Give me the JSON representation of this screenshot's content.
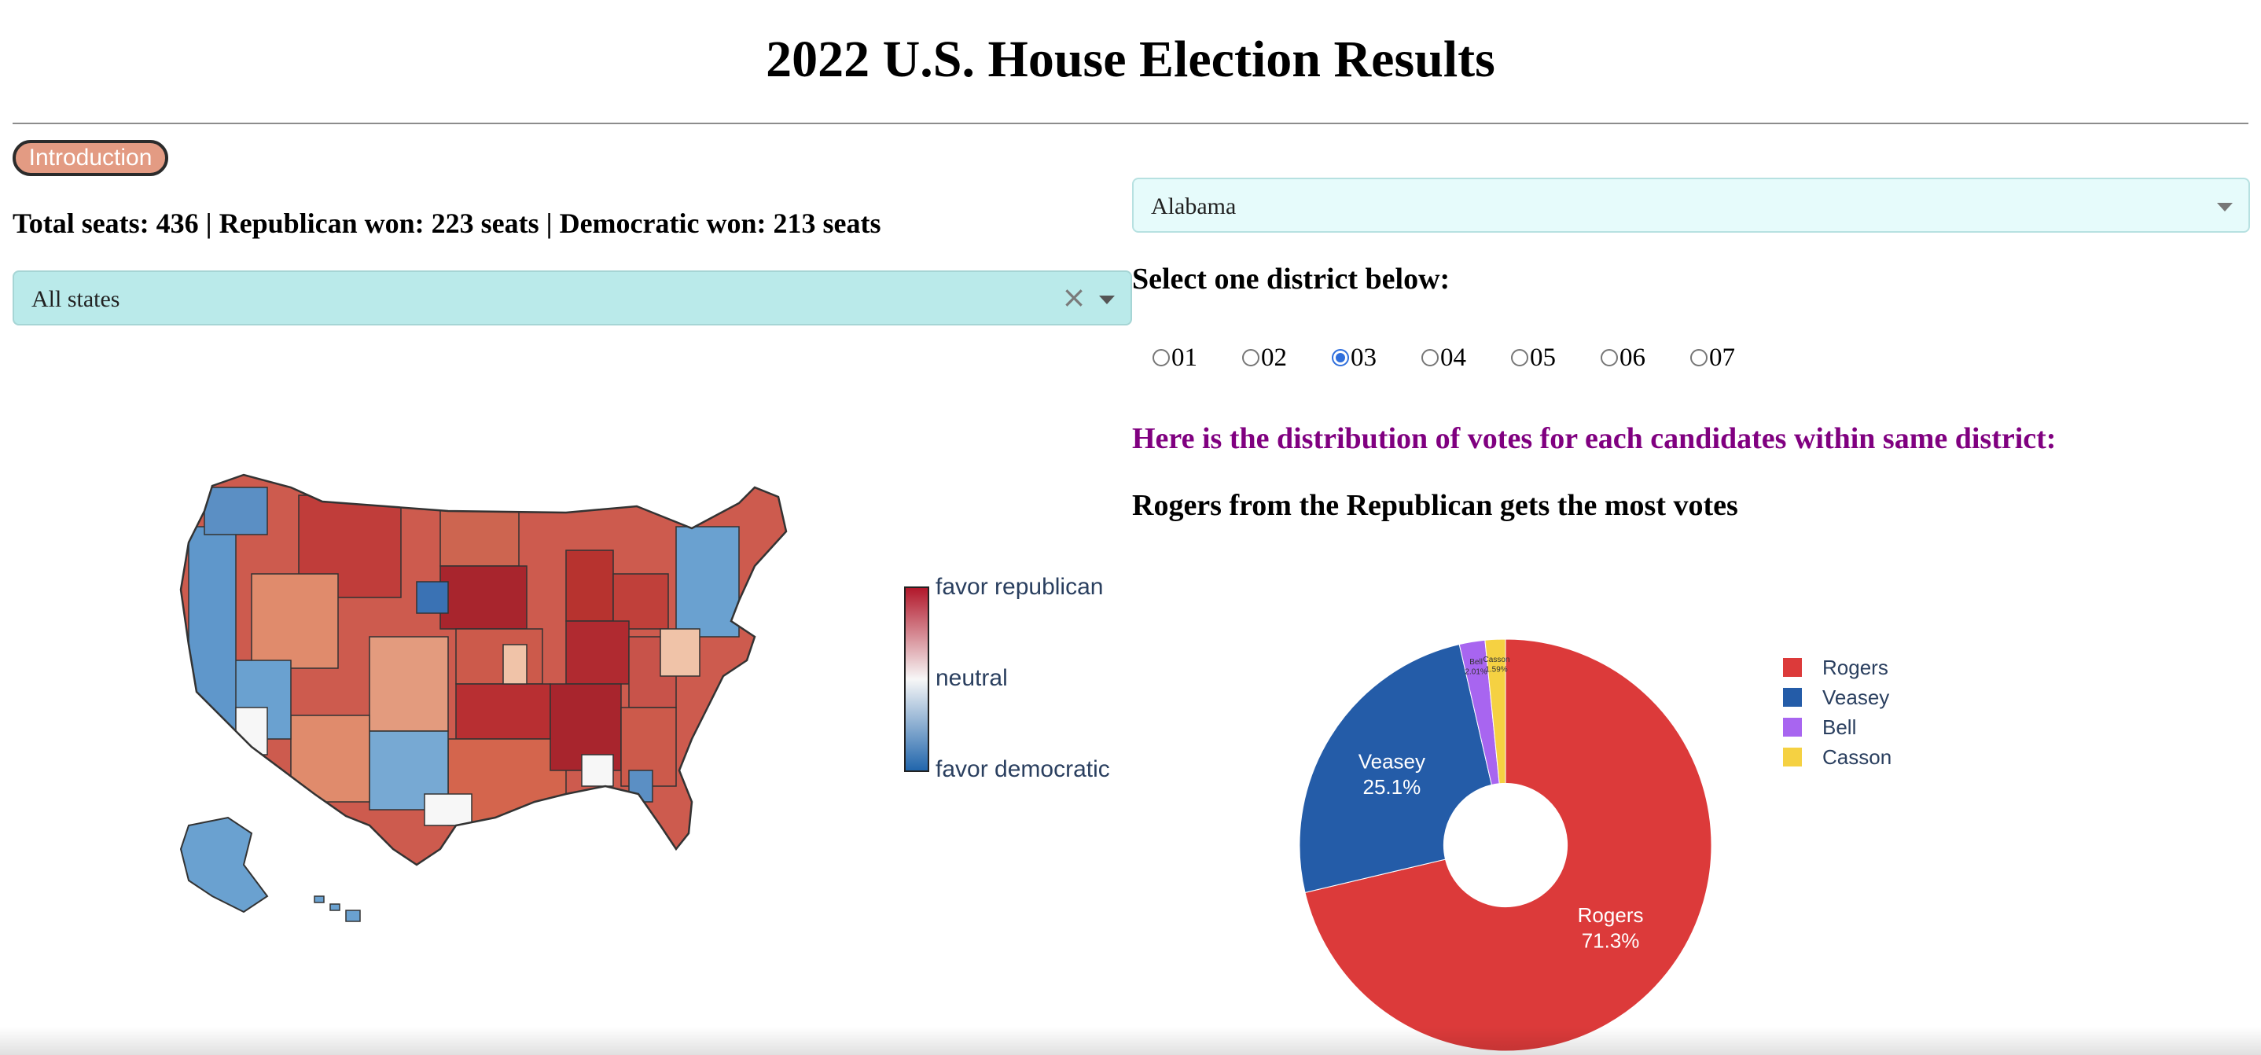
{
  "page": {
    "title": "2022 U.S. House Election Results",
    "intro_button": "Introduction",
    "summary": "Total seats: 436 | Republican won: 223 seats | Democratic won: 213 seats"
  },
  "filters": {
    "state_filter_value": "All states",
    "state_filter_clear": "×",
    "state_select_value": "Alabama"
  },
  "district": {
    "heading": "Select one district below:",
    "options": [
      "01",
      "02",
      "03",
      "04",
      "05",
      "06",
      "07"
    ],
    "selected": "03"
  },
  "results": {
    "distribution_heading": "Here is the distribution of votes for each candidates within same district:",
    "winner_text": "Rogers from the Republican gets the most votes"
  },
  "map": {
    "colorbar_labels": {
      "top": "favor republican",
      "middle": "neutral",
      "bottom": "favor democratic"
    },
    "colors": {
      "republican": "#b2182b",
      "neutral": "#f7f7f7",
      "democratic": "#2166ac"
    }
  },
  "chart_data": {
    "type": "pie",
    "hole": 0.3,
    "series": [
      {
        "name": "Rogers",
        "value": 71.3,
        "label": "71.3%",
        "color": "#dc3a3a"
      },
      {
        "name": "Veasey",
        "value": 25.1,
        "label": "25.1%",
        "color": "#245ca8"
      },
      {
        "name": "Bell",
        "value": 2.01,
        "label": "2.01%",
        "color": "#a865f0"
      },
      {
        "name": "Casson",
        "value": 1.59,
        "label": "1.59%",
        "color": "#f5d142"
      }
    ],
    "legend": [
      "Rogers",
      "Veasey",
      "Bell",
      "Casson"
    ],
    "legend_position": "right"
  }
}
